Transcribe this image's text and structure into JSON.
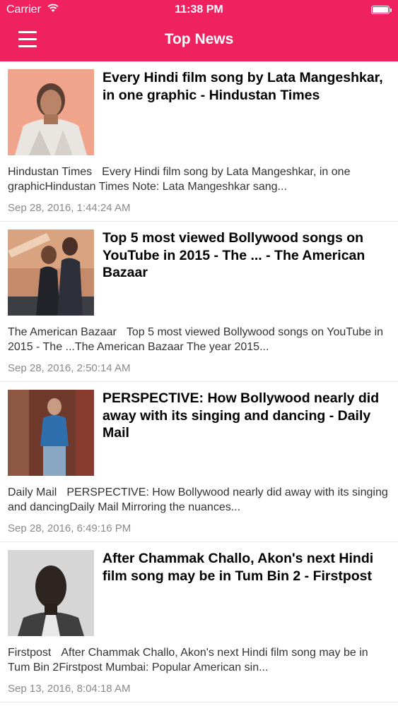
{
  "status": {
    "carrier": "Carrier",
    "time": "11:38 PM"
  },
  "nav": {
    "title": "Top News",
    "menu_icon": "hamburger-menu-icon"
  },
  "colors": {
    "accent": "#f0215f",
    "date_text": "#8a8a8a",
    "summary_text": "#333333"
  },
  "articles": [
    {
      "headline": "Every Hindi film song by Lata Mangeshkar, in one graphic - Hindustan Times",
      "source": "Hindustan Times",
      "snippet": "Every Hindi film song by Lata Mangeshkar, in one graphicHindustan Times  Note: Lata Mangeshkar sang...",
      "date": "Sep 28, 2016, 1:44:24 AM",
      "thumbnail": "portrait-photo"
    },
    {
      "headline": "Top 5 most viewed Bollywood songs on YouTube in 2015 - The ... - The American Bazaar",
      "source": "The American Bazaar",
      "snippet": "Top 5 most viewed Bollywood songs on YouTube in 2015 - The ...The American Bazaar  The year 2015...",
      "date": "Sep 28, 2016, 2:50:14 AM",
      "thumbnail": "couple-photo"
    },
    {
      "headline": "PERSPECTIVE: How Bollywood nearly did away with its singing and dancing - Daily Mail",
      "source": "Daily Mail",
      "snippet": "PERSPECTIVE: How Bollywood nearly did away with its singing and dancingDaily Mail  Mirroring the nuances...",
      "date": "Sep 28, 2016, 6:49:16 PM",
      "thumbnail": "man-standing-photo"
    },
    {
      "headline": "After Chammak Challo, Akon's next Hindi film song may be in Tum Bin 2 - Firstpost",
      "source": "Firstpost",
      "snippet": "After Chammak Challo, Akon's next Hindi film song may be in Tum Bin 2Firstpost  Mumbai: Popular American sin...",
      "date": "Sep 13, 2016, 8:04:18 AM",
      "thumbnail": "man-portrait-photo"
    }
  ]
}
